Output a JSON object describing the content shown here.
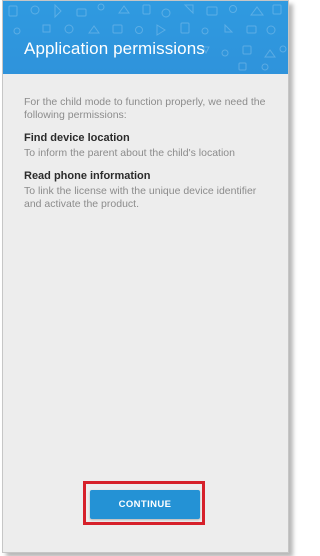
{
  "header": {
    "title": "Application permissions"
  },
  "intro_text": "For the child mode to function properly, we need the following permissions:",
  "permissions": [
    {
      "title": "Find device location",
      "description": "To inform the parent about the child's location"
    },
    {
      "title": "Read phone information",
      "description": "To link the license with the unique device identifier and activate the product."
    }
  ],
  "continue_label": "CONTINUE",
  "colors": {
    "header_blue": "#2f96de",
    "button_blue": "#2492d5",
    "highlight_red": "#d6202a",
    "background": "#ededed"
  }
}
